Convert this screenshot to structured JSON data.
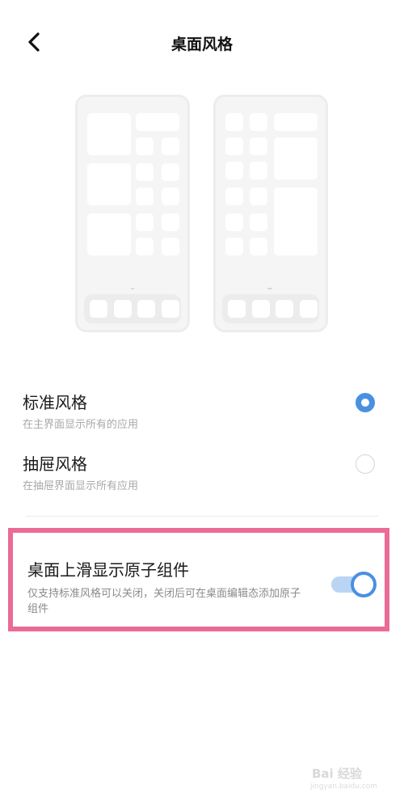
{
  "header": {
    "title": "桌面风格",
    "back_icon": "chevron-left-icon"
  },
  "styles": [
    {
      "title": "标准风格",
      "subtitle": "在主界面显示所有的应用",
      "selected": true
    },
    {
      "title": "抽屉风格",
      "subtitle": "在抽屉界面显示所有应用",
      "selected": false
    }
  ],
  "atom_widget": {
    "title": "桌面上滑显示原子组件",
    "subtitle": "仅支持标准风格可以关闭，关闭后可在桌面编辑态添加原子组件",
    "enabled": true
  },
  "colors": {
    "accent": "#4a90e2",
    "highlight_border": "#ea6b95",
    "toggle_track": "#b9d5f3"
  },
  "watermark": {
    "text": "Bai 经验",
    "url": "jingyan.baidu.com"
  }
}
